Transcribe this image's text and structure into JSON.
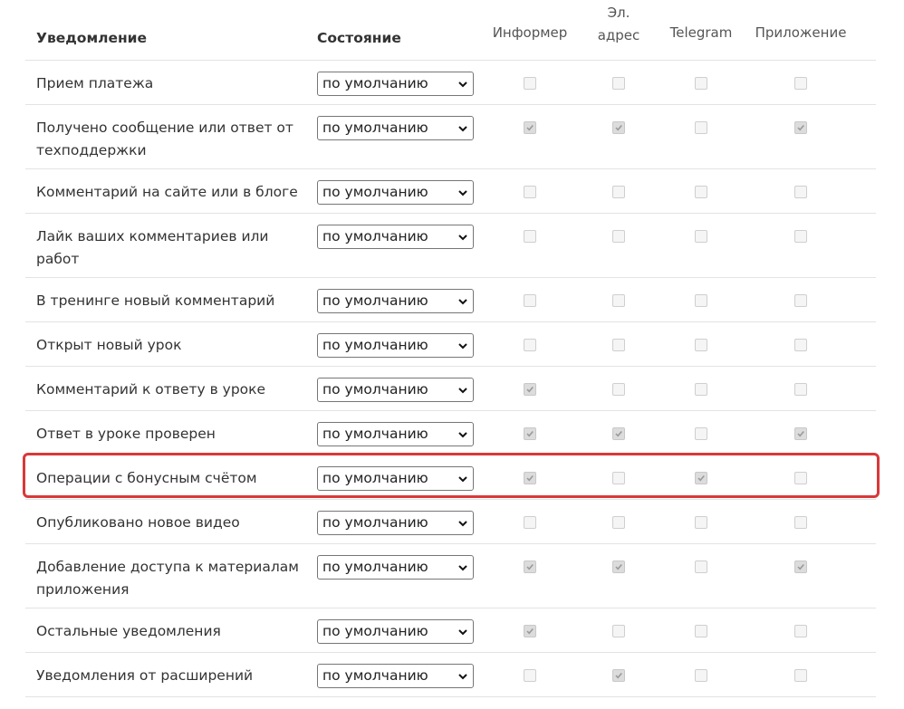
{
  "header": {
    "notification": "Уведомление",
    "state": "Состояние",
    "informer": "Информер",
    "email_line1": "Эл.",
    "email_line2": "адрес",
    "telegram": "Telegram",
    "app": "Приложение"
  },
  "rows": [
    {
      "label": "Прием платежа",
      "state": "по умолчанию",
      "informer": false,
      "email": false,
      "telegram": false,
      "app": false
    },
    {
      "label": "Получено сообщение или ответ от техподдержки",
      "state": "по умолчанию",
      "informer": true,
      "email": true,
      "telegram": false,
      "app": true
    },
    {
      "label": "Комментарий на сайте или в блоге",
      "state": "по умолчанию",
      "informer": false,
      "email": false,
      "telegram": false,
      "app": false
    },
    {
      "label": "Лайк ваших комментариев или работ",
      "state": "по умолчанию",
      "informer": false,
      "email": false,
      "telegram": false,
      "app": false
    },
    {
      "label": "В тренинге новый комментарий",
      "state": "по умолчанию",
      "informer": false,
      "email": false,
      "telegram": false,
      "app": false
    },
    {
      "label": "Открыт новый урок",
      "state": "по умолчанию",
      "informer": false,
      "email": false,
      "telegram": false,
      "app": false
    },
    {
      "label": "Комментарий к ответу в уроке",
      "state": "по умолчанию",
      "informer": true,
      "email": false,
      "telegram": false,
      "app": false
    },
    {
      "label": "Ответ в уроке проверен",
      "state": "по умолчанию",
      "informer": true,
      "email": true,
      "telegram": false,
      "app": true
    },
    {
      "label": "Операции с бонусным счётом",
      "state": "по умолчанию",
      "informer": true,
      "email": false,
      "telegram": true,
      "app": false
    },
    {
      "label": "Опубликовано новое видео",
      "state": "по умолчанию",
      "informer": false,
      "email": false,
      "telegram": false,
      "app": false
    },
    {
      "label": "Добавление доступа к материалам приложения",
      "state": "по умолчанию",
      "informer": true,
      "email": true,
      "telegram": false,
      "app": true
    },
    {
      "label": "Остальные уведомления",
      "state": "по умолчанию",
      "informer": true,
      "email": false,
      "telegram": false,
      "app": false
    },
    {
      "label": "Уведомления от расширений",
      "state": "по умолчанию",
      "informer": false,
      "email": true,
      "telegram": false,
      "app": false
    }
  ],
  "highlight_row": "Операции с бонусным счётом",
  "colors": {
    "highlight": "#d9383a",
    "border": "#e3e3e3",
    "text": "#333333"
  },
  "icons": {
    "select": "chevron-down-icon",
    "checkbox": "checkmark-icon"
  }
}
